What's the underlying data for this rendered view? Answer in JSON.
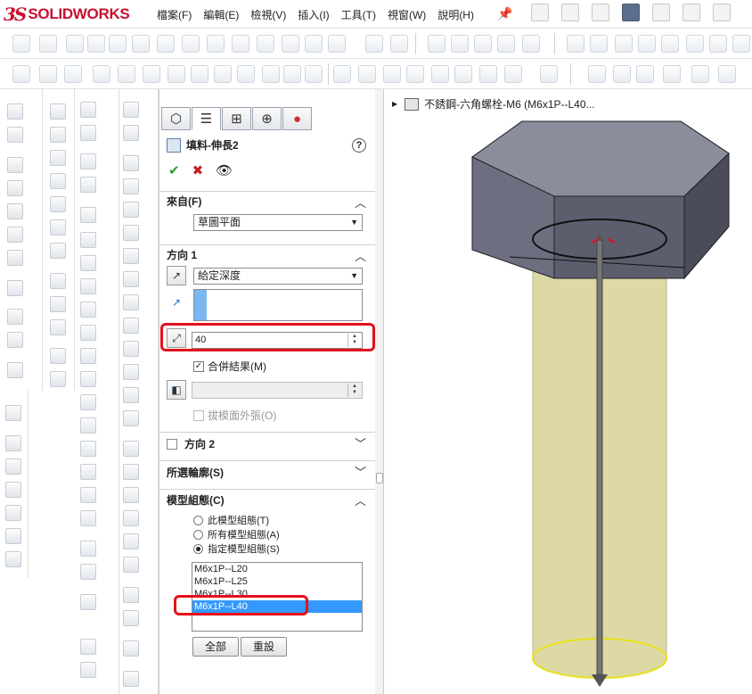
{
  "app": {
    "logo_prefix": "3S",
    "logo_name": "SOLIDWORKS"
  },
  "menu": [
    "檔案(F)",
    "編輯(E)",
    "檢視(V)",
    "插入(I)",
    "工具(T)",
    "視窗(W)",
    "說明(H)"
  ],
  "property_manager": {
    "feature_title": "填料-伸長2",
    "from_group": {
      "title": "來自(F)",
      "value": "草圖平面"
    },
    "direction1": {
      "title": "方向 1",
      "end_condition": "給定深度",
      "depth_value": "40",
      "merge_result": "合併結果(M)",
      "draft_outward": "拔模面外張(O)"
    },
    "direction2": {
      "title": "方向 2"
    },
    "selected_contours": {
      "title": "所選輪廓(S)"
    },
    "configurations": {
      "title": "模型組態(C)",
      "options": [
        "此模型組態(T)",
        "所有模型組態(A)",
        "指定模型組態(S)"
      ],
      "selected_option_index": 2,
      "list_items": [
        "M6x1P--L20",
        "M6x1P--L25",
        "M6x1P--L30",
        "M6x1P--L40"
      ],
      "selected_item_index": 3,
      "all_button": "全部",
      "reset_button": "重設"
    }
  },
  "viewport": {
    "tree_label": "不銹鋼-六角螺栓-M6  (M6x1P--L40..."
  },
  "colors": {
    "bolt_head": "#6d6f80",
    "bolt_shank": "#dcd9a6",
    "highlight": "#e3121b",
    "selection": "#3399ff",
    "edge_yellow": "#e8e01a"
  }
}
